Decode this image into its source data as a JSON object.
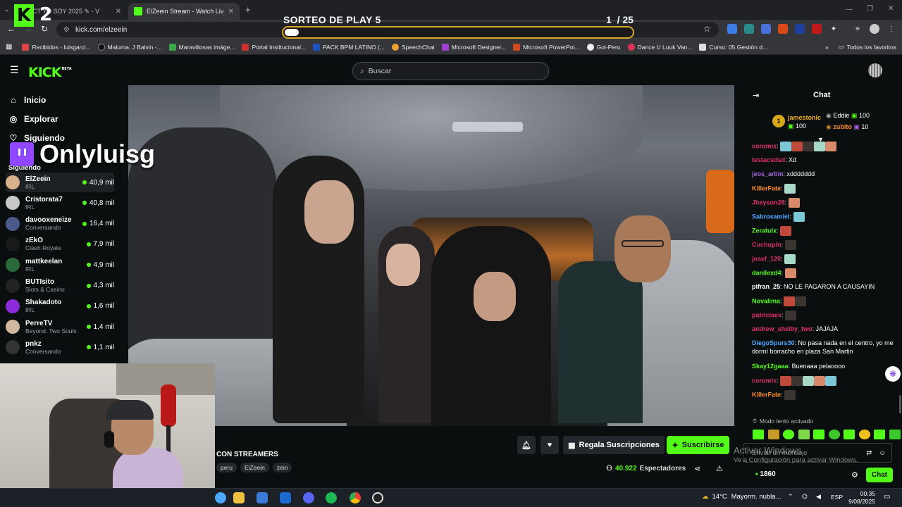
{
  "browser": {
    "tabs": [
      {
        "title": "CT YO SOY 2025 ✎ - V",
        "active": false
      },
      {
        "title": "ElZeein Stream - Watch Liv",
        "active": true
      }
    ],
    "url": "kick.com/elzeein",
    "new_tab": "+",
    "bookmarks": [
      "Recibidos - luisgarci...",
      "Maluma, J Balvin -...",
      "Maravillosas imáge...",
      "Portal Institucional...",
      "PACK BPM LATINO (...",
      "SpeechChat",
      "Microsoft Designer...",
      "Microsoft PowerPoi...",
      "Gol-Peru",
      "Dance U Luuk Van...",
      "Curso: 05 Gestión d..."
    ],
    "all_favorites": "Todos los favoritos"
  },
  "overlay": {
    "k2_logo": "2",
    "sorteo_title": "SORTEO DE PLAY 5",
    "sorteo_current": "1",
    "sorteo_total": "/ 25",
    "sorteo_progress": 0.04,
    "twitch_name": "Onlyluisg"
  },
  "header": {
    "logo": "KICK",
    "logo_beta": "BETA",
    "search_placeholder": "Buscar"
  },
  "sidebar": {
    "nav": [
      {
        "label": "Inicio",
        "icon": "home-icon"
      },
      {
        "label": "Explorar",
        "icon": "compass-icon"
      },
      {
        "label": "Siguiendo",
        "icon": "heart-icon"
      }
    ],
    "section": "Siguiendo",
    "channels": [
      {
        "name": "ElZeein",
        "category": "IRL",
        "viewers": "40,9 mil",
        "color": "#d9b28c"
      },
      {
        "name": "Cristorata7",
        "category": "IRL",
        "viewers": "40,8 mil",
        "color": "#c8c8c8"
      },
      {
        "name": "davooxeneize",
        "category": "Conversando",
        "viewers": "16,4 mil",
        "color": "#4a5a8a"
      },
      {
        "name": "zEkO",
        "category": "Clash Royale",
        "viewers": "7,9 mil",
        "color": "#1a1a1a"
      },
      {
        "name": "mattkeelan",
        "category": "IRL",
        "viewers": "4,9 mil",
        "color": "#2a6a3a"
      },
      {
        "name": "BUTIsito",
        "category": "Slots & Casino",
        "viewers": "4,3 mil",
        "color": "#222"
      },
      {
        "name": "Shakadoto",
        "category": "IRL",
        "viewers": "1,6 mil",
        "color": "#8a2ad8"
      },
      {
        "name": "PerreTV",
        "category": "Beyond: Two Souls",
        "viewers": "1,4 mil",
        "color": "#d0b8a0"
      },
      {
        "name": "pnkz",
        "category": "Conversando",
        "viewers": "1,1 mil",
        "color": "#333"
      }
    ]
  },
  "stream": {
    "title": "CON STREAMERS",
    "tags": [
      "peru",
      "ElZeein",
      "zein"
    ],
    "viewers": "40.922",
    "viewers_label": "Espectadores",
    "gift_label": "Regala Suscripciones",
    "subscribe_label": "Suscribirse"
  },
  "chat": {
    "title": "Chat",
    "leaderboard": [
      {
        "rank": "1",
        "name": "jamestonic",
        "value": "100"
      },
      {
        "name": "Eddie",
        "value": "100"
      },
      {
        "name": "zubito",
        "value": "10"
      }
    ],
    "messages": [
      {
        "user": "coromis",
        "color": "#e0306a",
        "text": "",
        "emotes": 5
      },
      {
        "user": "testacsdsd",
        "color": "#e0306a",
        "text": "Xd",
        "emotes": 0
      },
      {
        "user": "jeos_arlim",
        "color": "#a862e0",
        "text": "xddddddd",
        "emotes": 0
      },
      {
        "user": "KillerFate",
        "color": "#ff8c2a",
        "text": "",
        "emotes": 1
      },
      {
        "user": "Jheyson28",
        "color": "#e0306a",
        "text": "",
        "emotes": 1
      },
      {
        "user": "Sabrosamiel",
        "color": "#4aa8ff",
        "text": "",
        "emotes": 1
      },
      {
        "user": "Zeratulx",
        "color": "#53fc18",
        "text": "",
        "emotes": 1
      },
      {
        "user": "Cuchupin",
        "color": "#e0306a",
        "text": "",
        "emotes": 1
      },
      {
        "user": "josef_120",
        "color": "#e0306a",
        "text": "",
        "emotes": 1
      },
      {
        "user": "danilexd4",
        "color": "#53fc18",
        "text": "",
        "emotes": 1
      },
      {
        "user": "pifran_25",
        "color": "#ffffff",
        "text": "NO LE PAGARON A CAUSAYIN",
        "emotes": 0
      },
      {
        "user": "Novalima",
        "color": "#53fc18",
        "text": "",
        "emotes": 2
      },
      {
        "user": "patriciaex",
        "color": "#e0306a",
        "text": "",
        "emotes": 1
      },
      {
        "user": "andrew_shelby_two",
        "color": "#e0306a",
        "text": "JAJAJA",
        "emotes": 0
      },
      {
        "user": "DiegoSpurs30",
        "color": "#4aa8ff",
        "text": "No pasa nada en el centro, yo me dormí borracho en plaza San Martin",
        "emotes": 0
      },
      {
        "user": "Skay12gaaa",
        "color": "#53fc18",
        "text": "Buenaaa pelaoooo",
        "emotes": 0
      },
      {
        "user": "coromis",
        "color": "#e0306a",
        "text": "",
        "emotes": 5
      },
      {
        "user": "KillerFate",
        "color": "#ff8c2a",
        "text": "",
        "emotes": 1
      }
    ],
    "slow_mode": "Modo lento activado",
    "input_placeholder": "Enviar un mensaje",
    "points": "1860",
    "send_label": "Chat"
  },
  "watermark": {
    "line1": "Activar Windows",
    "line2": "Ve a Configuración para activar Windows."
  },
  "taskbar": {
    "weather": "14°C",
    "weather_text": "Mayorm. nubla...",
    "lang": "ESP",
    "time": "00:35",
    "date": "9/08/2025"
  },
  "colors": {
    "kick_green": "#53fc18",
    "background": "#0b0e0f"
  }
}
